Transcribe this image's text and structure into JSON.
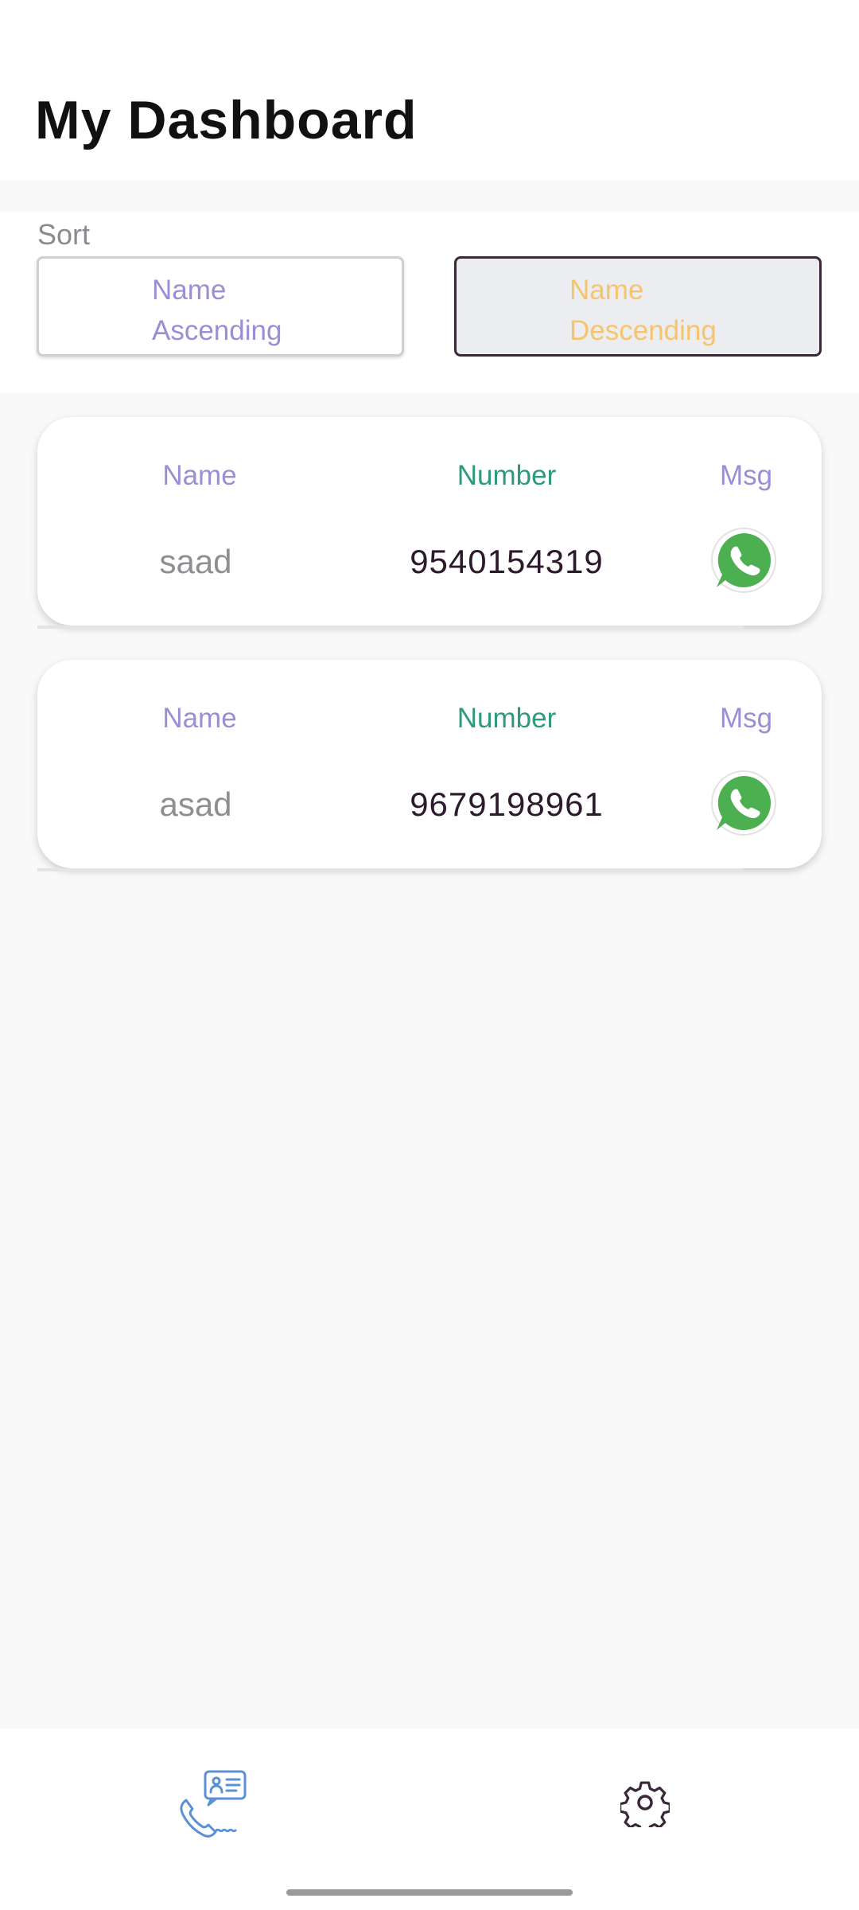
{
  "header": {
    "title": "My Dashboard"
  },
  "sort": {
    "label": "Sort",
    "ascending": {
      "line1": "Name",
      "line2": "Ascending"
    },
    "descending": {
      "line1": "Name",
      "line2": "Descending",
      "selected": true
    }
  },
  "contacts": [
    {
      "name_header": "Name",
      "number_header": "Number",
      "msg_header": "Msg",
      "name": "saad",
      "number": "9540154319",
      "msg_icon": "whatsapp-icon"
    },
    {
      "name_header": "Name",
      "number_header": "Number",
      "msg_header": "Msg",
      "name": "asad",
      "number": "9679198961",
      "msg_icon": "whatsapp-icon"
    }
  ],
  "bottom_nav": {
    "items": [
      {
        "icon": "phone-contact-icon",
        "active": true
      },
      {
        "icon": "gear-icon",
        "active": false
      }
    ]
  },
  "colors": {
    "accent_purple": "#9b8ed4",
    "accent_green": "#2e9a7b",
    "accent_orange": "#f7c46e",
    "whatsapp_green": "#4caf50"
  }
}
